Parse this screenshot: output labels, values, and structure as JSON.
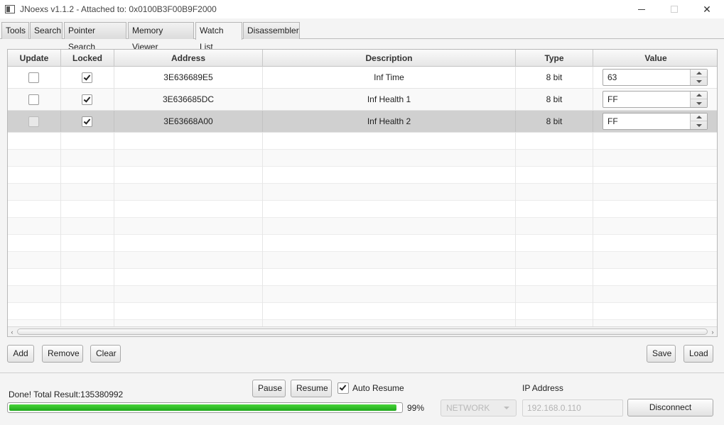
{
  "window": {
    "title": "JNoexs v1.1.2 - Attached to: 0x0100B3F00B9F2000"
  },
  "tabs": [
    {
      "label": "Tools"
    },
    {
      "label": "Search"
    },
    {
      "label": "Pointer Search"
    },
    {
      "label": "Memory Viewer"
    },
    {
      "label": "Watch List",
      "active": true
    },
    {
      "label": "Disassembler"
    }
  ],
  "table": {
    "columns": [
      "Update",
      "Locked",
      "Address",
      "Description",
      "Type",
      "Value"
    ],
    "rows": [
      {
        "update": false,
        "locked": true,
        "address": "3E636689E5",
        "description": "Inf Time",
        "type": "8 bit",
        "value": "63"
      },
      {
        "update": false,
        "locked": true,
        "address": "3E636685DC",
        "description": "Inf Health 1",
        "type": "8 bit",
        "value": "FF"
      },
      {
        "update": false,
        "locked": true,
        "address": "3E63668A00",
        "description": "Inf Health 2",
        "type": "8 bit",
        "value": "FF",
        "selected": true
      }
    ]
  },
  "actions": {
    "add": "Add",
    "remove": "Remove",
    "clear": "Clear",
    "save": "Save",
    "load": "Load"
  },
  "footer": {
    "status": "Done! Total Result:135380992",
    "progress_percent": 99,
    "progress_label": "99%",
    "pause": "Pause",
    "resume": "Resume",
    "auto_resume": "Auto Resume",
    "auto_resume_checked": true,
    "connection_type": "NETWORK",
    "ip_label": "IP Address",
    "ip_placeholder": "192.168.0.110",
    "disconnect": "Disconnect"
  },
  "colors": {
    "progress": "#1fb41a",
    "selected_row": "#d0d0d0"
  }
}
